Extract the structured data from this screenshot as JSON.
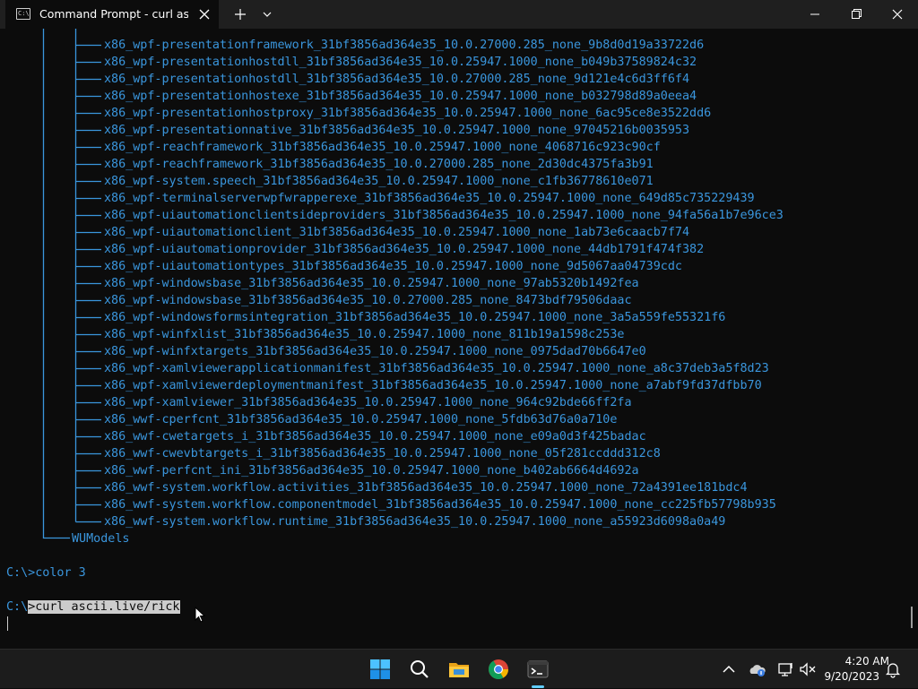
{
  "window": {
    "tab_title": "Command Prompt - curl  ascii",
    "tab_icon_text": "C:\\"
  },
  "terminal": {
    "text_color": "#3a96dd",
    "background": "#0c0c0c",
    "packages": [
      "x86_wpf-presentationframework_31bf3856ad364e35_10.0.27000.285_none_9b8d0d19a33722d6",
      "x86_wpf-presentationhostdll_31bf3856ad364e35_10.0.25947.1000_none_b049b37589824c32",
      "x86_wpf-presentationhostdll_31bf3856ad364e35_10.0.27000.285_none_9d121e4c6d3ff6f4",
      "x86_wpf-presentationhostexe_31bf3856ad364e35_10.0.25947.1000_none_b032798d89a0eea4",
      "x86_wpf-presentationhostproxy_31bf3856ad364e35_10.0.25947.1000_none_6ac95ce8e3522dd6",
      "x86_wpf-presentationnative_31bf3856ad364e35_10.0.25947.1000_none_97045216b0035953",
      "x86_wpf-reachframework_31bf3856ad364e35_10.0.25947.1000_none_4068716c923c90cf",
      "x86_wpf-reachframework_31bf3856ad364e35_10.0.27000.285_none_2d30dc4375fa3b91",
      "x86_wpf-system.speech_31bf3856ad364e35_10.0.25947.1000_none_c1fb36778610e071",
      "x86_wpf-terminalserverwpfwrapperexe_31bf3856ad364e35_10.0.25947.1000_none_649d85c735229439",
      "x86_wpf-uiautomationclientsideproviders_31bf3856ad364e35_10.0.25947.1000_none_94fa56a1b7e96ce3",
      "x86_wpf-uiautomationclient_31bf3856ad364e35_10.0.25947.1000_none_1ab73e6caacb7f74",
      "x86_wpf-uiautomationprovider_31bf3856ad364e35_10.0.25947.1000_none_44db1791f474f382",
      "x86_wpf-uiautomationtypes_31bf3856ad364e35_10.0.25947.1000_none_9d5067aa04739cdc",
      "x86_wpf-windowsbase_31bf3856ad364e35_10.0.25947.1000_none_97ab5320b1492fea",
      "x86_wpf-windowsbase_31bf3856ad364e35_10.0.27000.285_none_8473bdf79506daac",
      "x86_wpf-windowsformsintegration_31bf3856ad364e35_10.0.25947.1000_none_3a5a559fe55321f6",
      "x86_wpf-winfxlist_31bf3856ad364e35_10.0.25947.1000_none_811b19a1598c253e",
      "x86_wpf-winfxtargets_31bf3856ad364e35_10.0.25947.1000_none_0975dad70b6647e0",
      "x86_wpf-xamlviewerapplicationmanifest_31bf3856ad364e35_10.0.25947.1000_none_a8c37deb3a5f8d23",
      "x86_wpf-xamlviewerdeploymentmanifest_31bf3856ad364e35_10.0.25947.1000_none_a7abf9fd37dfbb70",
      "x86_wpf-xamlviewer_31bf3856ad364e35_10.0.25947.1000_none_964c92bde66ff2fa",
      "x86_wwf-cperfcnt_31bf3856ad364e35_10.0.25947.1000_none_5fdb63d76a0a710e",
      "x86_wwf-cwetargets_i_31bf3856ad364e35_10.0.25947.1000_none_e09a0d3f425badac",
      "x86_wwf-cwevbtargets_i_31bf3856ad364e35_10.0.25947.1000_none_05f281ccddd312c8",
      "x86_wwf-perfcnt_ini_31bf3856ad364e35_10.0.25947.1000_none_b402ab6664d4692a",
      "x86_wwf-system.workflow.activities_31bf3856ad364e35_10.0.25947.1000_none_72a4391ee181bdc4",
      "x86_wwf-system.workflow.componentmodel_31bf3856ad364e35_10.0.25947.1000_none_cc225fb57798b935",
      "x86_wwf-system.workflow.runtime_31bf3856ad364e35_10.0.25947.1000_none_a55923d6098a0a49"
    ],
    "last_folder": "WUModels",
    "prompt1": {
      "prefix": "C:\\>",
      "command": "color 3"
    },
    "prompt2": {
      "prefix": "C:\\",
      "selected": ">curl ascii.live/rick"
    }
  },
  "taskbar": {
    "accent": "#60cdff",
    "apps": [
      {
        "name": "start-icon"
      },
      {
        "name": "search-icon"
      },
      {
        "name": "file-explorer-icon"
      },
      {
        "name": "chrome-icon"
      },
      {
        "name": "terminal-icon"
      }
    ],
    "tray": [
      "chevron-up-icon",
      "onedrive-icon",
      "network-icon",
      "volume-muted-icon",
      "notification-bell-icon"
    ],
    "clock": {
      "time": "4:20 AM",
      "date": "9/20/2023"
    }
  }
}
